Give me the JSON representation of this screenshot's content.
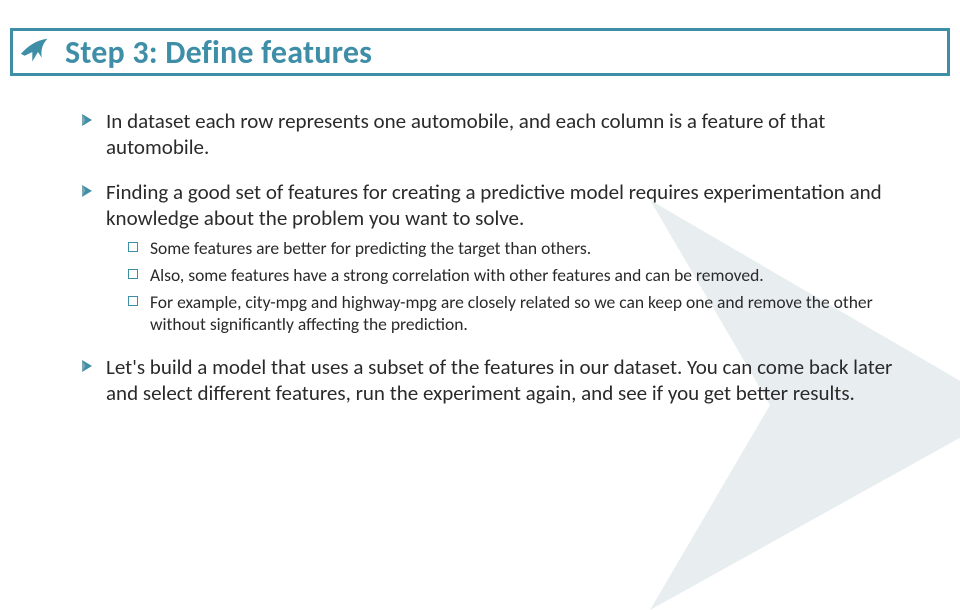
{
  "title": "Step 3: Define features",
  "bullets": [
    {
      "text": "In dataset each row represents one automobile, and each column is a feature of that automobile.",
      "sub": []
    },
    {
      "text": "Finding a good set of features for creating a predictive model requires experimentation and knowledge about the problem you want to solve.",
      "sub": [
        "Some features are better for predicting the target than others.",
        "Also, some features have a strong correlation with other features and can be removed.",
        "For example, city-mpg and highway-mpg are closely related so we can keep one and remove the other without significantly affecting the prediction."
      ]
    },
    {
      "text": "Let's build a model that uses a subset of the features in our dataset. You can come back later and select different features, run the experiment again, and see if you get better results.",
      "sub": []
    }
  ],
  "colors": {
    "accent": "#3f8ea8",
    "text": "#2a2a2a"
  }
}
